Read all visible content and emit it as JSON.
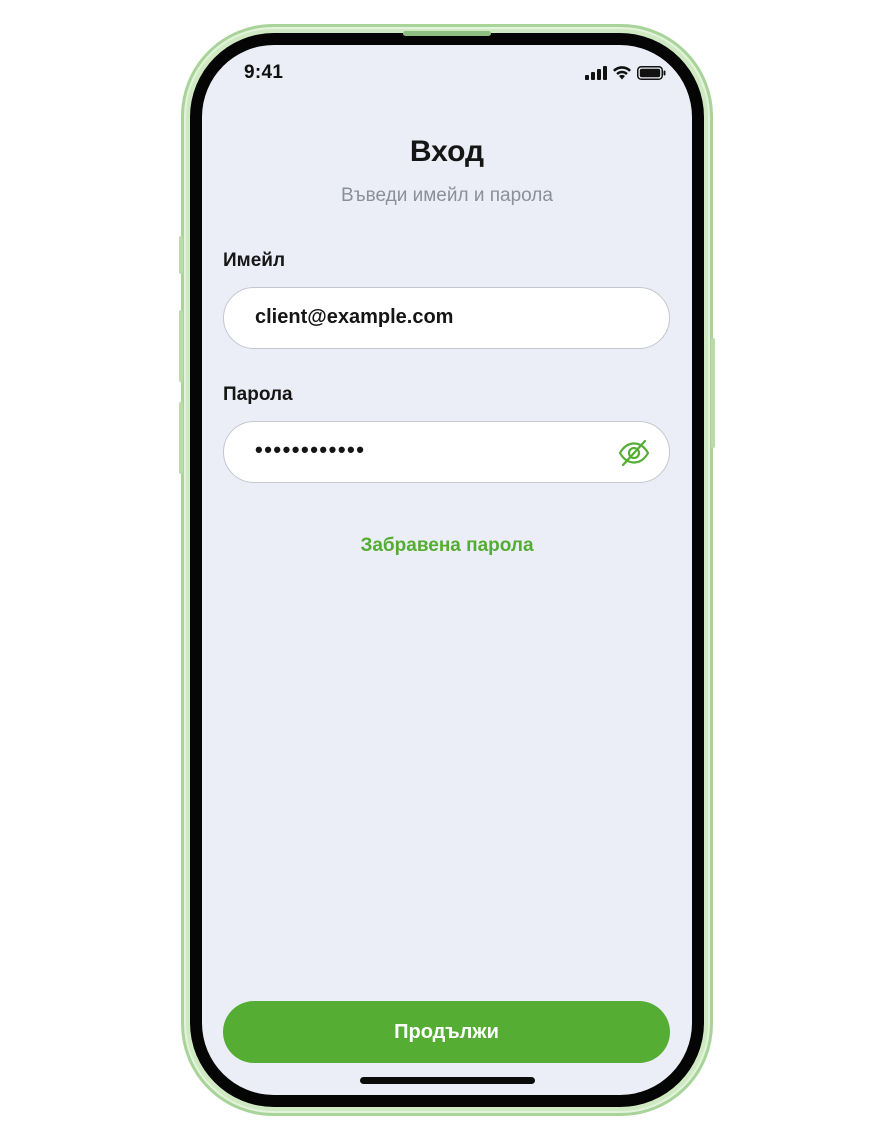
{
  "status_bar": {
    "time": "9:41",
    "icons": [
      "cellular-signal-icon",
      "wifi-icon",
      "battery-icon"
    ]
  },
  "header": {
    "title": "Вход",
    "subtitle": "Въведи имейл и парола"
  },
  "form": {
    "email": {
      "label": "Имейл",
      "value": "client@example.com"
    },
    "password": {
      "label": "Парола",
      "masked_value": "••••••••••••",
      "visibility_icon": "eye-slash-icon"
    },
    "forgot_password": "Забравена парола"
  },
  "footer": {
    "continue_label": "Продължи"
  },
  "colors": {
    "accent": "#55ae33",
    "screen_background": "#eceef7",
    "frame": "#cfe9c2"
  }
}
